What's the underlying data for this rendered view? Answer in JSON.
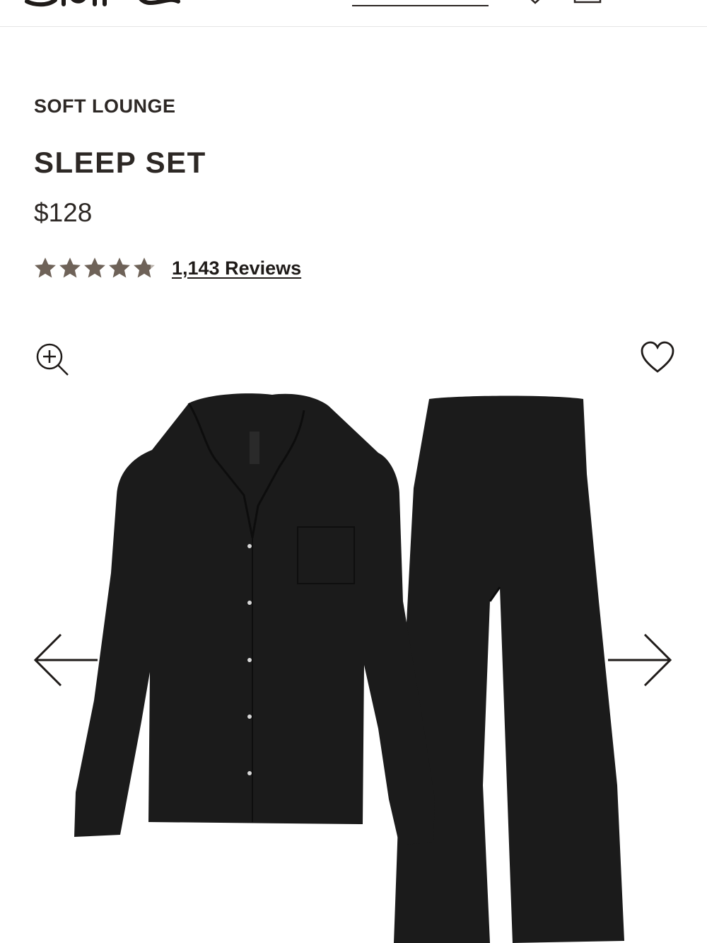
{
  "header": {
    "logo_icon": "brand-logo-script",
    "search_icon": "search-underline",
    "icons": [
      "heart-icon",
      "bag-icon"
    ]
  },
  "product": {
    "collection": "SOFT LOUNGE",
    "title": "SLEEP SET",
    "price": "$128",
    "rating": {
      "value": 4.8,
      "max": 5,
      "color": "#6e6258"
    },
    "reviews_label": "1,143 Reviews"
  },
  "gallery": {
    "zoom_icon": "zoom-in-icon",
    "favorite_icon": "heart-outline-icon",
    "prev_icon": "arrow-left-icon",
    "next_icon": "arrow-right-icon",
    "image": "black-ribbed-pajama-shirt-and-wide-leg-pants",
    "garment_color": "#1b1b1b"
  }
}
